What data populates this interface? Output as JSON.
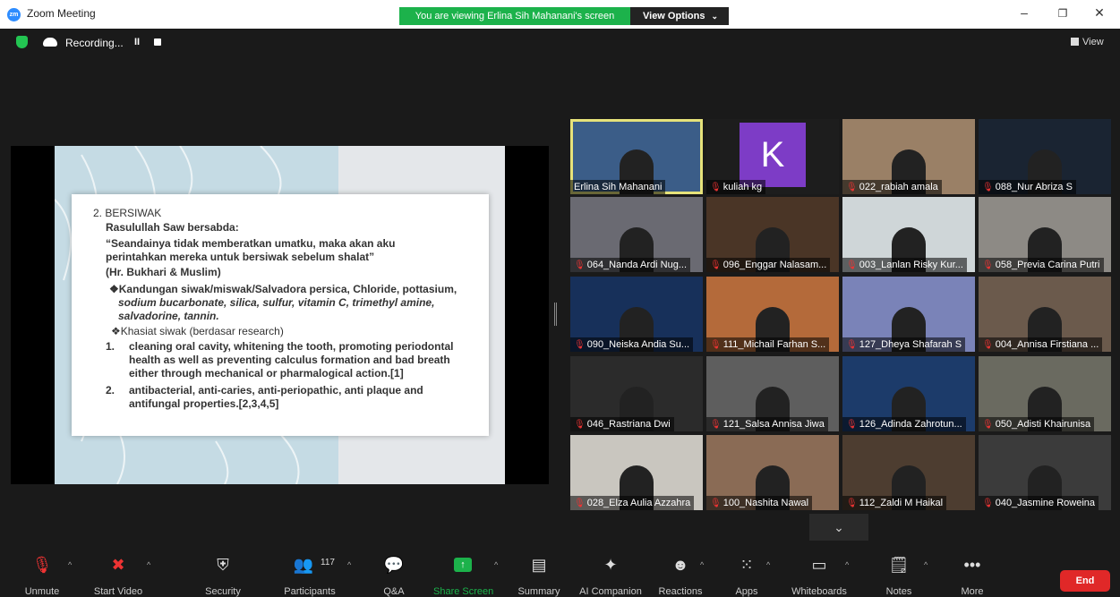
{
  "window": {
    "title": "Zoom Meeting",
    "logo_text": "zm"
  },
  "banner": {
    "viewing_text": "You are viewing Erlina Sih Mahanani's screen",
    "view_options_label": "View Options"
  },
  "status": {
    "recording_label": "Recording...",
    "pause_label": "II",
    "view_label": "View"
  },
  "slide": {
    "heading": "2. BERSIWAK",
    "line1": "Rasulullah Saw bersabda:",
    "line2": "“Seandainya tidak memberatkan umatku, maka akan aku",
    "line3": "perintahkan mereka untuk bersiwak sebelum shalat”",
    "line4": "(Hr. Bukhari & Muslim)",
    "line5": "❖Kandungan siwak/miswak/Salvadora persica, Chloride, pottasium,",
    "line6": "sodium bucarbonate, silica, sulfur, vitamin C, trimethyl amine,",
    "line7": "salvadorine, tannin.",
    "line8": "❖Khasiat siwak (berdasar research)",
    "item1_num": "1.",
    "item1_l1": "cleaning oral cavity, whitening the tooth, promoting periodontal",
    "item1_l2": "health as well as preventing calculus formation and bad breath",
    "item1_l3": "either through mechanical or pharmalogical action.[1]",
    "item2_num": "2.",
    "item2_l1": "antibacterial, anti-caries, anti-periopathic, anti plaque and",
    "item2_l2": "antifungal properties.[2,3,4,5]"
  },
  "participants": [
    {
      "name": "Erlina Sih Mahanani",
      "muted": false,
      "bg": "#3b5d88"
    },
    {
      "name": "kuliah kg",
      "muted": true,
      "bg": "#1d1d1d",
      "avatar_letter": "K"
    },
    {
      "name": "022_rabiah amala",
      "muted": true,
      "bg": "#9a8066"
    },
    {
      "name": "088_Nur Abriza S",
      "muted": true,
      "bg": "#1a2432"
    },
    {
      "name": "064_Nanda Ardi Nug...",
      "muted": true,
      "bg": "#6a6a72"
    },
    {
      "name": "096_Enggar Nalasam...",
      "muted": true,
      "bg": "#4a3526"
    },
    {
      "name": "003_Lanlan Risky Kur...",
      "muted": true,
      "bg": "#cfd6d8"
    },
    {
      "name": "058_Previa Carina Putri",
      "muted": true,
      "bg": "#8d8a85"
    },
    {
      "name": "090_Neiska Andia Su...",
      "muted": true,
      "bg": "#17305a"
    },
    {
      "name": "111_Michail Farhan S...",
      "muted": true,
      "bg": "#b46a3a"
    },
    {
      "name": "127_Dheya Shafarah S",
      "muted": true,
      "bg": "#7a83b8"
    },
    {
      "name": "004_Annisa Firstiana ...",
      "muted": true,
      "bg": "#6b5a4c"
    },
    {
      "name": "046_Rastriana Dwi",
      "muted": true,
      "bg": "#2b2b2b"
    },
    {
      "name": "121_Salsa Annisa Jiwa",
      "muted": true,
      "bg": "#5e5e5e"
    },
    {
      "name": "126_Adinda Zahrotun...",
      "muted": true,
      "bg": "#1c3b6a"
    },
    {
      "name": "050_Adisti Khairunisa",
      "muted": true,
      "bg": "#6a6a60"
    },
    {
      "name": "028_Elza Aulia Azzahra",
      "muted": true,
      "bg": "#c9c6bf"
    },
    {
      "name": "100_Nashita Nawal",
      "muted": true,
      "bg": "#8a6b55"
    },
    {
      "name": "112_Zaldi M Haikal",
      "muted": true,
      "bg": "#4d3d30"
    },
    {
      "name": "040_Jasmine Roweina",
      "muted": true,
      "bg": "#3b3b3b"
    }
  ],
  "toolbar": {
    "unmute": "Unmute",
    "start_video": "Start Video",
    "security": "Security",
    "participants": "Participants",
    "participants_count": "117",
    "qa": "Q&A",
    "share_screen": "Share Screen",
    "summary": "Summary",
    "ai_companion": "AI Companion",
    "reactions": "Reactions",
    "apps": "Apps",
    "whiteboards": "Whiteboards",
    "notes": "Notes",
    "more": "More",
    "end": "End"
  },
  "colors": {
    "share_green": "#1cb24b",
    "end_red": "#e02828",
    "muted_red": "#e33333",
    "active_speaker": "#e6e27a"
  }
}
